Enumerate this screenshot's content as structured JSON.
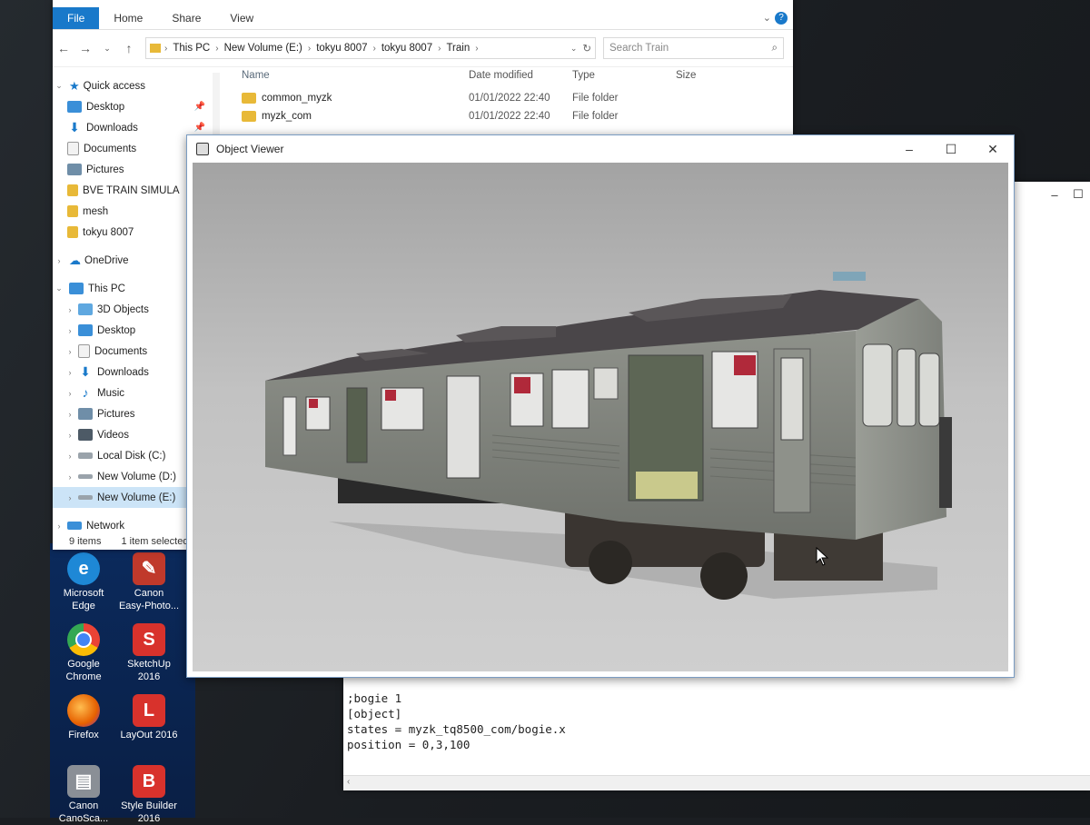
{
  "explorer": {
    "window_title_partial": "Train",
    "ribbon_tabs": [
      "File",
      "Home",
      "Share",
      "View"
    ],
    "address": [
      "This PC",
      "New Volume (E:)",
      "tokyu 8007",
      "tokyu 8007",
      "Train"
    ],
    "search_placeholder": "Search Train",
    "columns": {
      "name": "Name",
      "date": "Date modified",
      "type": "Type",
      "size": "Size"
    },
    "files": [
      {
        "name": "common_myzk",
        "date": "01/01/2022 22:40",
        "type": "File folder",
        "size": ""
      },
      {
        "name": "myzk_com",
        "date": "01/01/2022 22:40",
        "type": "File folder",
        "size": ""
      }
    ],
    "nav": {
      "quick_access": "Quick access",
      "quick_items": [
        "Desktop",
        "Downloads",
        "Documents",
        "Pictures",
        "BVE TRAIN SIMULA",
        "mesh",
        "tokyu 8007"
      ],
      "onedrive": "OneDrive",
      "this_pc": "This PC",
      "pc_items": [
        "3D Objects",
        "Desktop",
        "Documents",
        "Downloads",
        "Music",
        "Pictures",
        "Videos",
        "Local Disk (C:)",
        "New Volume (D:)",
        "New Volume (E:)"
      ],
      "network": "Network"
    },
    "status": {
      "items": "9 items",
      "selected": "1 item selected"
    }
  },
  "viewer": {
    "title": "Object Viewer"
  },
  "notepad": {
    "lines": [
      ";bogie 1",
      "[object]",
      "states = myzk_tq8500_com/bogie.x",
      "position = 0,3,100"
    ]
  },
  "desktop_icons": [
    {
      "line1": "Microsoft",
      "line2": "Edge",
      "icon": "edge-icon",
      "color": "#1e88d6"
    },
    {
      "line1": "Canon",
      "line2": "Easy-Photo...",
      "icon": "canon-photo-icon",
      "color": "#c0392b"
    },
    {
      "line1": "Google",
      "line2": "Chrome",
      "icon": "chrome-icon",
      "color": "#34a853"
    },
    {
      "line1": "SketchUp",
      "line2": "2016",
      "icon": "sketchup-icon",
      "color": "#d8322c"
    },
    {
      "line1": "Firefox",
      "line2": "",
      "icon": "firefox-icon",
      "color": "#e66000"
    },
    {
      "line1": "LayOut 2016",
      "line2": "",
      "icon": "layout-icon",
      "color": "#d8322c"
    },
    {
      "line1": "Canon",
      "line2": "CanoSca...",
      "icon": "canon-scan-icon",
      "color": "#8a8f96"
    },
    {
      "line1": "Style Builder",
      "line2": "2016",
      "icon": "style-builder-icon",
      "color": "#d8322c"
    }
  ]
}
